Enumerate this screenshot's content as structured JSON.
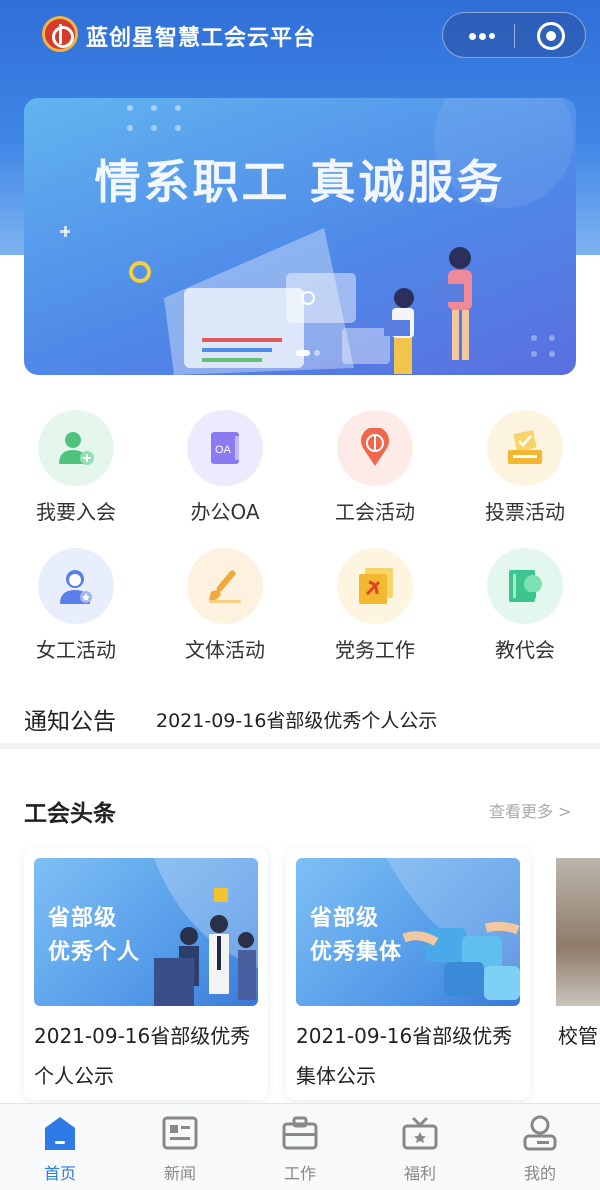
{
  "header": {
    "title": "蓝创星智慧工会云平台",
    "logo_icon": "union-emblem-icon",
    "capsule": {
      "more_icon": "more-dots-icon",
      "close_icon": "close-circle-icon"
    }
  },
  "banner": {
    "headline": "情系职工  真诚服务",
    "slide_index": 1,
    "slide_total": 2
  },
  "grid": [
    {
      "label": "我要入会",
      "icon": "add-member-icon",
      "color": "#4fc27e",
      "bg": "#e5f7ec"
    },
    {
      "label": "办公OA",
      "icon": "oa-book-icon",
      "color": "#7a6be8",
      "bg": "#eceafc"
    },
    {
      "label": "工会活动",
      "icon": "union-location-icon",
      "color": "#f0674d",
      "bg": "#fdebe7"
    },
    {
      "label": "投票活动",
      "icon": "ballot-box-icon",
      "color": "#f2b630",
      "bg": "#fdf4e0"
    },
    {
      "label": "女工活动",
      "icon": "female-worker-icon",
      "color": "#5b7ee8",
      "bg": "#e8eefc"
    },
    {
      "label": "文体活动",
      "icon": "paint-brush-icon",
      "color": "#f1a93a",
      "bg": "#fdf2e0"
    },
    {
      "label": "党务工作",
      "icon": "party-flag-icon",
      "color": "#f2b830",
      "bg": "#fdf5df"
    },
    {
      "label": "教代会",
      "icon": "lightbulb-book-icon",
      "color": "#3cc58e",
      "bg": "#e3f7ee"
    }
  ],
  "notice": {
    "label": "通知公告",
    "text": "2021-09-16省部级优秀个人公示"
  },
  "headlines": {
    "title": "工会头条",
    "more": "查看更多 >",
    "cards": [
      {
        "image_text_1": "省部级",
        "image_text_2": "优秀个人",
        "title": "2021-09-16省部级优秀个人公示"
      },
      {
        "image_text_1": "省部级",
        "image_text_2": "优秀集体",
        "title": "2021-09-16省部级优秀集体公示"
      },
      {
        "title": "校管"
      }
    ]
  },
  "tabbar": {
    "active": "home",
    "active_color": "#2e7be6",
    "items": [
      {
        "label": "首页",
        "icon": "home-icon"
      },
      {
        "label": "新闻",
        "icon": "news-icon"
      },
      {
        "label": "工作",
        "icon": "briefcase-icon"
      },
      {
        "label": "福利",
        "icon": "gift-box-icon"
      },
      {
        "label": "我的",
        "icon": "user-icon"
      }
    ]
  }
}
